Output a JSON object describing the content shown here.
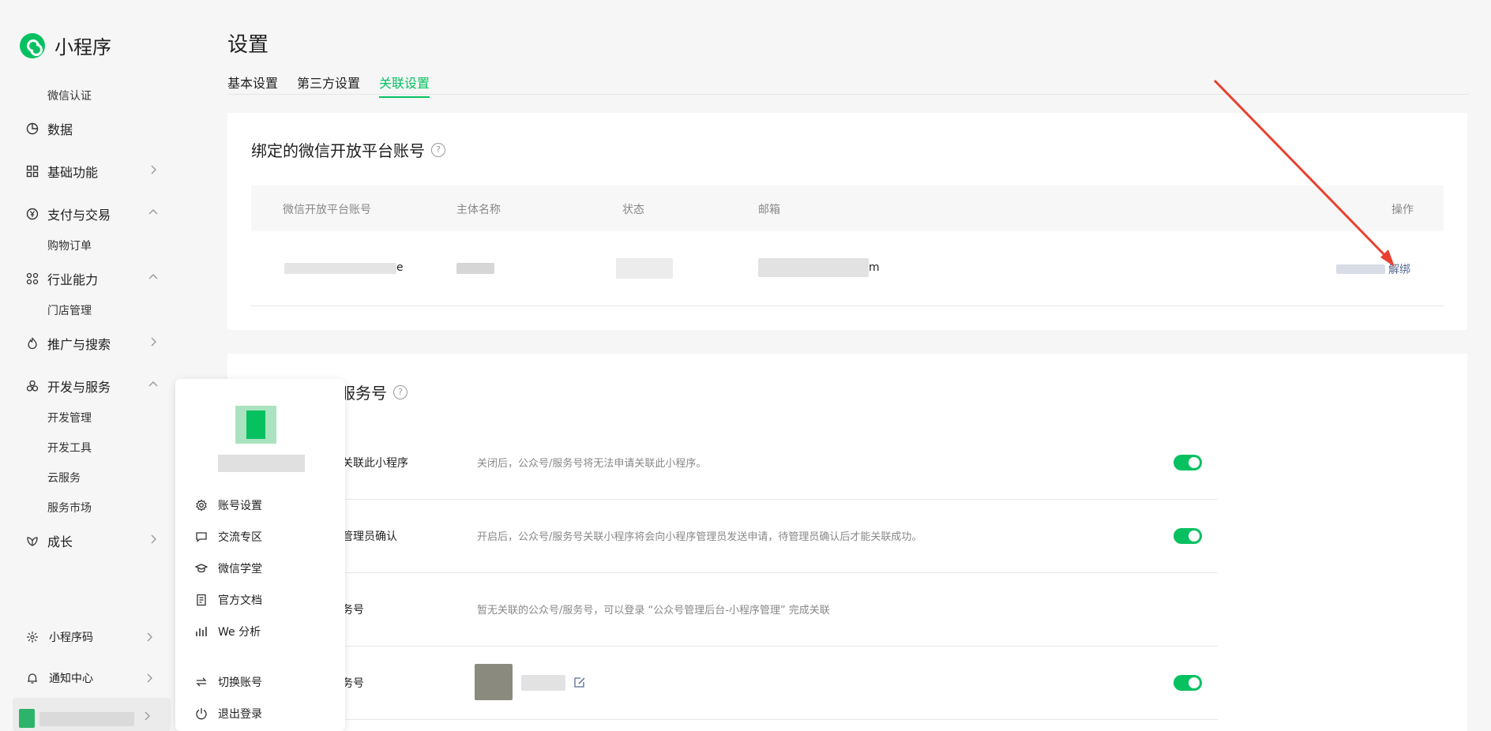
{
  "app": {
    "name": "小程序"
  },
  "sidebar": {
    "items": [
      {
        "type": "sub",
        "label": "微信认证"
      },
      {
        "type": "nav",
        "label": "数据",
        "icon": "pie-chart-icon"
      },
      {
        "type": "nav",
        "label": "基础功能",
        "icon": "grid-icon",
        "chevron": "right"
      },
      {
        "type": "nav",
        "label": "支付与交易",
        "icon": "yen-circle-icon",
        "chevron": "up"
      },
      {
        "type": "sub",
        "label": "购物订单"
      },
      {
        "type": "nav",
        "label": "行业能力",
        "icon": "industry-icon",
        "chevron": "up"
      },
      {
        "type": "sub",
        "label": "门店管理"
      },
      {
        "type": "nav",
        "label": "推广与搜索",
        "icon": "flame-icon",
        "chevron": "right"
      },
      {
        "type": "nav",
        "label": "开发与服务",
        "icon": "cluster-icon",
        "chevron": "up"
      },
      {
        "type": "sub",
        "label": "开发管理"
      },
      {
        "type": "sub",
        "label": "开发工具"
      },
      {
        "type": "sub",
        "label": "云服务"
      },
      {
        "type": "sub",
        "label": "服务市场"
      },
      {
        "type": "nav",
        "label": "成长",
        "icon": "growth-icon",
        "chevron": "right"
      }
    ],
    "bottom": [
      {
        "label": "小程序码",
        "icon": "sun-code-icon"
      },
      {
        "label": "通知中心",
        "icon": "bell-icon"
      }
    ]
  },
  "page": {
    "title": "设置",
    "tabs": [
      {
        "label": "基本设置",
        "active": false
      },
      {
        "label": "第三方设置",
        "active": false
      },
      {
        "label": "关联设置",
        "active": true
      }
    ]
  },
  "open_platform": {
    "title": "绑定的微信开放平台账号",
    "columns": [
      "微信开放平台账号",
      "主体名称",
      "状态",
      "邮箱",
      "操作"
    ],
    "row": {
      "account_suffix": "e",
      "email_suffix": "m",
      "action": "解绑"
    }
  },
  "service_account": {
    "title_partial": "服务号",
    "rows": [
      {
        "label": "关联此小程序",
        "desc": "关闭后，公众号/服务号将无法申请关联此小程序。",
        "toggle": true
      },
      {
        "label": "管理员确认",
        "desc": "开启后，公众号/服务号关联小程序将会向小程序管理员发送申请，待管理员确认后才能关联成功。",
        "toggle": true
      },
      {
        "label": "务号",
        "desc": "暂无关联的公众号/服务号，可以登录 “公众号管理后台-小程序管理” 完成关联",
        "toggle": false
      },
      {
        "label": "务号",
        "desc": "",
        "toggle": true
      }
    ]
  },
  "popup_menu": {
    "items": [
      {
        "label": "账号设置",
        "icon": "gear-icon"
      },
      {
        "label": "交流专区",
        "icon": "chat-icon"
      },
      {
        "label": "微信学堂",
        "icon": "graduation-cap-icon"
      },
      {
        "label": "官方文档",
        "icon": "document-icon"
      },
      {
        "label": "We 分析",
        "icon": "analysis-icon"
      },
      {
        "label": "切换账号",
        "icon": "switch-icon"
      },
      {
        "label": "退出登录",
        "icon": "power-icon"
      }
    ]
  },
  "colors": {
    "accent": "#07c160",
    "link": "#576b95",
    "annotation_arrow": "#e8412f"
  }
}
